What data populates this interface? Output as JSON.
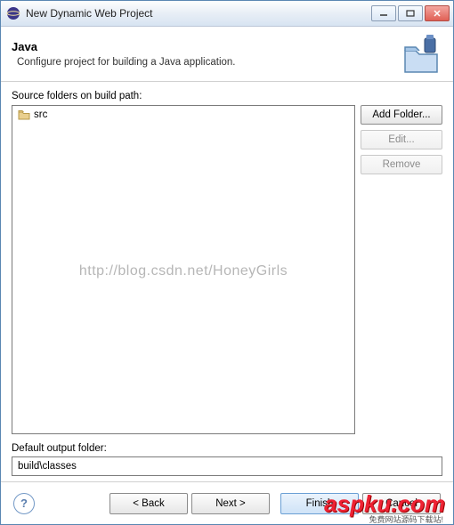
{
  "window": {
    "title": "New Dynamic Web Project"
  },
  "banner": {
    "title": "Java",
    "subtitle": "Configure project for building a Java application."
  },
  "source": {
    "label": "Source folders on build path:",
    "items": [
      {
        "name": "src"
      }
    ],
    "buttons": {
      "add": "Add Folder...",
      "edit": "Edit...",
      "remove": "Remove"
    }
  },
  "watermark": "http://blog.csdn.net/HoneyGirls",
  "output": {
    "label": "Default output folder:",
    "value": "build\\classes"
  },
  "footer": {
    "back": "< Back",
    "next": "Next >",
    "finish": "Finish",
    "cancel": "Cancel"
  },
  "overlay": {
    "logo": "aspku.com",
    "sub": "免费网站源码下载站!"
  }
}
